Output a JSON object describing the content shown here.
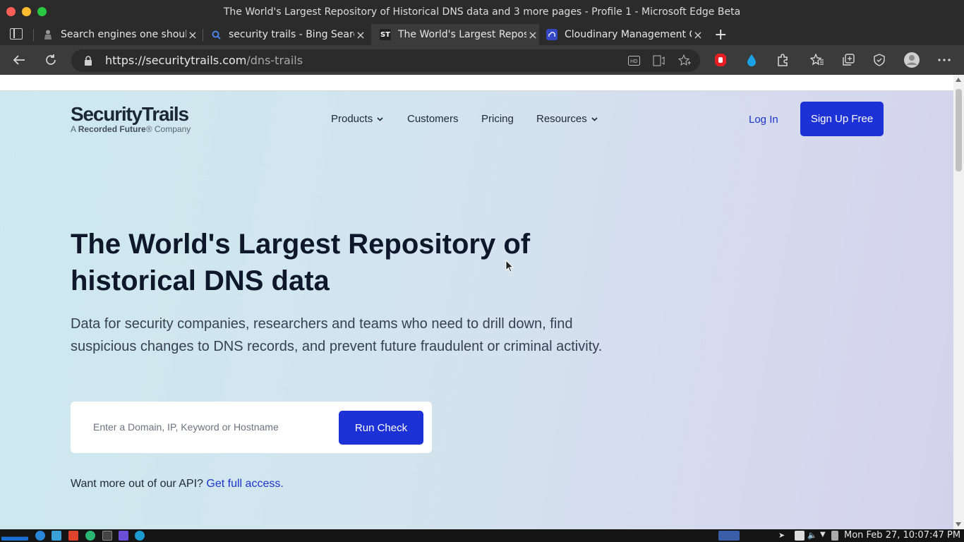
{
  "window": {
    "title": "The World's Largest Repository of Historical DNS data and 3 more pages - Profile 1 - Microsoft Edge Beta"
  },
  "tabs": [
    {
      "label": "Search engines one should",
      "icon": "person-icon"
    },
    {
      "label": "security trails - Bing Search",
      "icon": "bing-search-icon"
    },
    {
      "label": "The World's Largest Repository",
      "icon": "st-icon",
      "favicon_text": "ST",
      "active": true
    },
    {
      "label": "Cloudinary Management Console",
      "icon": "cloudinary-icon"
    }
  ],
  "address_bar": {
    "url_domain": "https://securitytrails.com",
    "url_path": "/dns-trails"
  },
  "site": {
    "logo_main": "SecurityTrails",
    "logo_sub_prefix": "A ",
    "logo_sub_brand": "Recorded Future",
    "logo_sub_suffix": "® Company",
    "nav": {
      "products": "Products",
      "customers": "Customers",
      "pricing": "Pricing",
      "resources": "Resources"
    },
    "login": "Log In",
    "signup": "Sign Up Free",
    "headline": "The World's Largest Repository of historical DNS data",
    "subtext": "Data for security companies, researchers and teams who need to drill down, find suspicious changes to DNS records, and prevent future fraudulent or criminal activity.",
    "search_placeholder": "Enter a Domain, IP, Keyword or Hostname",
    "run_check": "Run Check",
    "api_text": "Want more out of our API?",
    "api_link": "Get full access."
  },
  "taskbar": {
    "clock": "Mon Feb 27, 10:07:47 PM"
  },
  "colors": {
    "brand_blue": "#1d32d6",
    "link_blue": "#1c34c9",
    "title_bar": "#2b2b2b",
    "toolbar": "#3b3b3b"
  }
}
